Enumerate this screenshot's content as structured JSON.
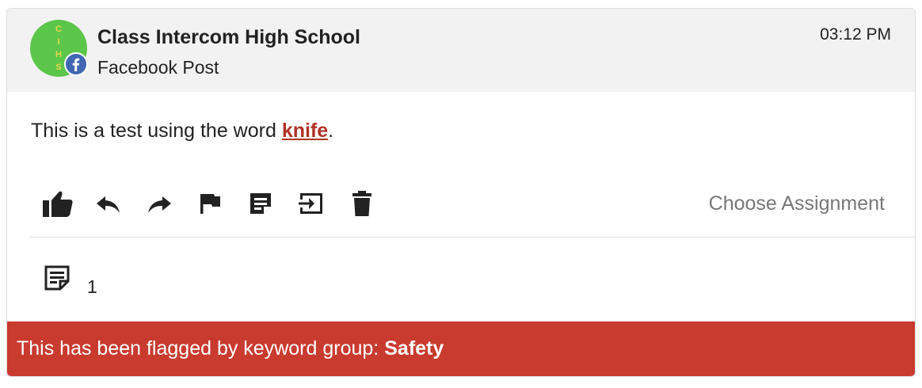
{
  "post": {
    "author": "Class Intercom High School",
    "avatar_letters": [
      "C",
      "I",
      "H",
      "S"
    ],
    "source": "Facebook Post",
    "time": "03:12 PM",
    "message_before": "This is a test using the word ",
    "keyword": "knife",
    "message_after": "."
  },
  "actions": [
    {
      "name": "like",
      "icon": "thumbs-up-icon"
    },
    {
      "name": "reply",
      "icon": "reply-icon"
    },
    {
      "name": "forward",
      "icon": "forward-icon"
    },
    {
      "name": "flag",
      "icon": "flag-icon"
    },
    {
      "name": "note",
      "icon": "note-icon"
    },
    {
      "name": "export",
      "icon": "exit-to-app-icon"
    },
    {
      "name": "delete",
      "icon": "trash-icon"
    }
  ],
  "assignment": {
    "label": "Choose Assignment"
  },
  "notes": {
    "icon": "note-icon",
    "count": "1"
  },
  "flag": {
    "text": "This has been flagged by keyword group:",
    "group": "Safety"
  },
  "colors": {
    "header_bg": "#f2f2f2",
    "avatar": "#5cc64a",
    "keyword": "#b03226",
    "banner": "#c93a2f",
    "facebook": "#4267b2",
    "muted_text": "#777777"
  }
}
